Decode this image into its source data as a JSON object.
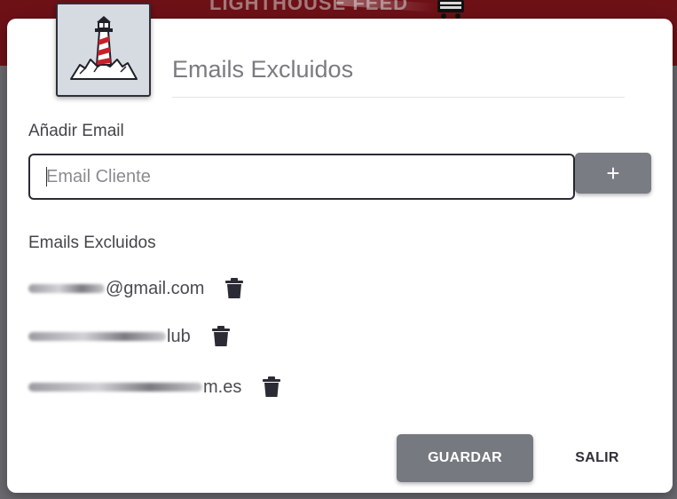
{
  "app": {
    "brand_text": "LIGHTHOUSE FEED"
  },
  "dialog": {
    "title": "Emails Excluidos",
    "add_section": {
      "label": "Añadir Email",
      "input_placeholder": "Email Cliente",
      "input_value": "",
      "add_button_label": "+"
    },
    "list_section": {
      "label": "Emails Excluidos",
      "emails": [
        {
          "visible_suffix": "@gmail.com"
        },
        {
          "visible_suffix": "lub"
        },
        {
          "visible_suffix": "m.es"
        }
      ]
    },
    "actions": {
      "save_label": "GUARDAR",
      "exit_label": "SALIR"
    }
  },
  "colors": {
    "header_bg": "#6e1117",
    "overlay_bg": "#6a6a70",
    "primary_button": "#777980",
    "text_dark": "#2f3039",
    "lighthouse_red": "#c8202a"
  },
  "icons": {
    "logo": "lighthouse-logo-icon",
    "delete": "trash-icon",
    "cart": "cart-icon"
  }
}
